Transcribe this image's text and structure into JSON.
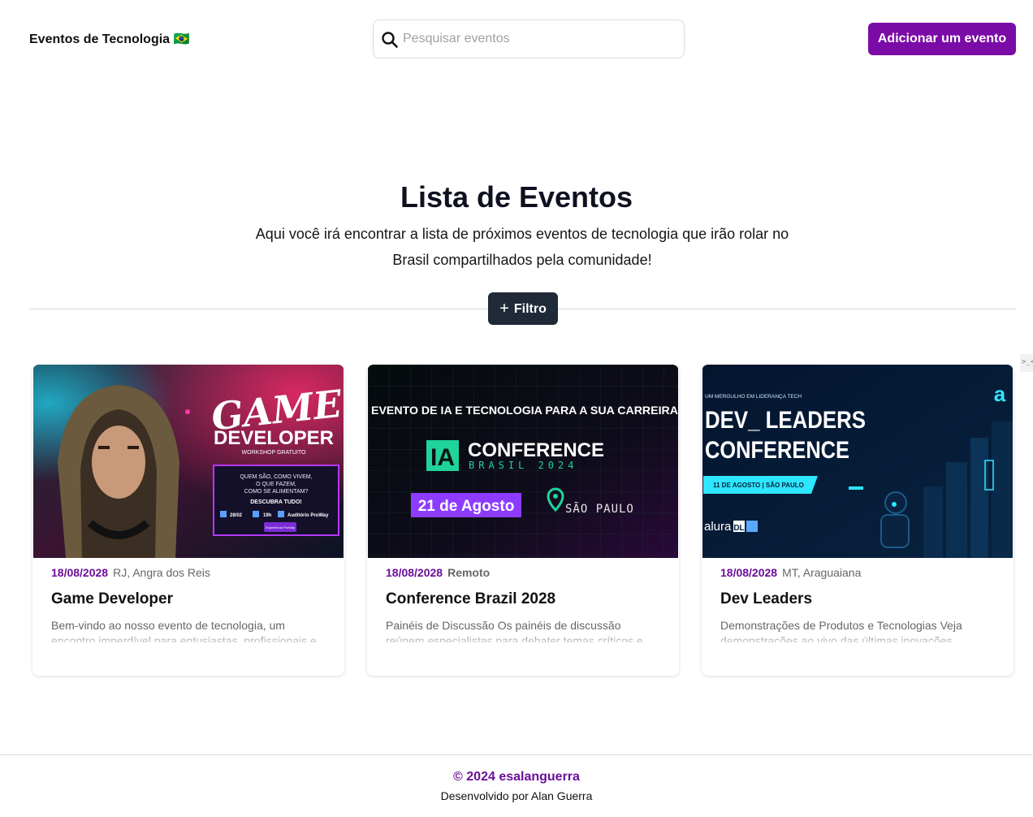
{
  "header": {
    "brand": "Eventos de Tecnologia 🇧🇷",
    "search_placeholder": "Pesquisar eventos",
    "add_button": "Adicionar um evento"
  },
  "hero": {
    "title": "Lista de Eventos",
    "subtitle": "Aqui você irá encontrar a lista de próximos eventos de tecnologia que irão rolar no Brasil compartilhados pela comunidade!",
    "filter_button": "Filtro"
  },
  "events": [
    {
      "date": "18/08/2028",
      "location": "RJ, Angra dos Reis",
      "title": "Game Developer",
      "description": "Bem-vindo ao nosso evento de tecnologia, um encontro imperdível para entusiastas, profissionais e",
      "image": {
        "line1": "GAME",
        "line2": "DEVELOPER",
        "line3": "WORKSHOP GRATUITO",
        "box_l1": "QUEM SÃO, COMO VIVEM,",
        "box_l2": "O QUE FAZEM,",
        "box_l3": "COMO SE ALIMENTAM?",
        "box_l4": "DESCUBRA TUDO!",
        "info_date": "28/02",
        "info_time": "19h",
        "info_place": "Auditório ProWay",
        "logo": "Experiência ProWay"
      }
    },
    {
      "date": "18/08/2028",
      "location": "Remoto",
      "title": "Conference Brazil 2028",
      "description": "Painéis de Discussão Os painéis de discussão reúnem especialistas para debater temas críticos e",
      "image": {
        "top": "EVENTO DE IA E TECNOLOGIA PARA A SUA CARREIRA",
        "badge": "IA",
        "conf": "CONFERENCE",
        "sub": "BRASIL 2024",
        "date": "21 de Agosto",
        "city": "SÃO PAULO"
      }
    },
    {
      "date": "18/08/2028",
      "location": "MT, Araguaiana",
      "title": "Dev Leaders",
      "description": "Demonstrações de Produtos e Tecnologias Veja demonstrações ao vivo das últimas inovações",
      "image": {
        "top": "UM MERGULHO EM LIDERANÇA TECH",
        "line1": "DEV_ LEADERS",
        "line2": "CONFERENCE",
        "tag": "11 DE AGOSTO | SÃO PAULO",
        "brand": "alura",
        "brand2": "DL",
        "corner": "a"
      }
    }
  ],
  "footer": {
    "copyright": "© 2024 esalanguerra",
    "credit": "Desenvolvido por Alan Guerra"
  },
  "side_tab": ">_<"
}
